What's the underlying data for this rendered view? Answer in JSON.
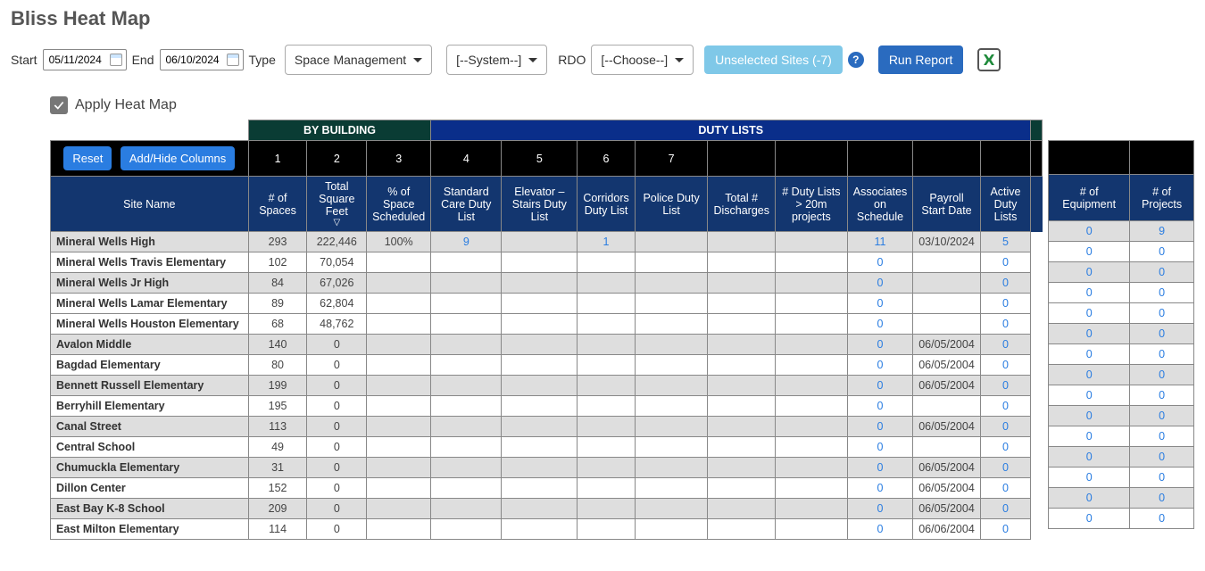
{
  "title": "Bliss Heat Map",
  "controls": {
    "start_label": "Start",
    "start_value": "05/11/2024",
    "end_label": "End",
    "end_value": "06/10/2024",
    "type_label": "Type",
    "type_value": "Space Management",
    "system_value": "[--System--]",
    "rdo_label": "RDO",
    "rdo_value": "[--Choose--]",
    "unselected_label": "Unselected Sites (-7)",
    "run_label": "Run Report"
  },
  "apply_heat_map_label": "Apply Heat Map",
  "bands": {
    "by_building": "BY BUILDING",
    "duty_lists": "DUTY LISTS"
  },
  "numcols": [
    "1",
    "2",
    "3",
    "4",
    "5",
    "6",
    "7"
  ],
  "buttons": {
    "reset": "Reset",
    "addhide": "Add/Hide Columns"
  },
  "headers": {
    "site": "Site Name",
    "spaces": "# of Spaces",
    "sqft": "Total Square Feet",
    "pct_sched": "% of Space Scheduled",
    "std_care": "Standard Care Duty List",
    "elevator": "Elevator – Stairs Duty List",
    "corridors": "Corridors Duty List",
    "police": "Police Duty List",
    "discharges": "Total # Discharges",
    "duty20m": "# Duty Lists > 20m projects",
    "assoc": "Associates on Schedule",
    "payroll": "Payroll Start Date",
    "active": "Active Duty Lists",
    "equip": "# of Equipment",
    "projects": "# of Projects"
  },
  "rows": [
    {
      "shade": true,
      "site": "Mineral Wells High",
      "spaces": "293",
      "sqft": "222,446",
      "pct": "100%",
      "std": "9",
      "elev": "",
      "corr": "1",
      "pol": "",
      "disch": "",
      "d20": "",
      "assoc": "11",
      "payroll": "03/10/2024",
      "active": "5",
      "equip": "0",
      "proj": "9"
    },
    {
      "shade": false,
      "site": "Mineral Wells Travis Elementary",
      "spaces": "102",
      "sqft": "70,054",
      "pct": "",
      "std": "",
      "elev": "",
      "corr": "",
      "pol": "",
      "disch": "",
      "d20": "",
      "assoc": "0",
      "payroll": "",
      "active": "0",
      "equip": "0",
      "proj": "0"
    },
    {
      "shade": true,
      "site": "Mineral Wells Jr High",
      "spaces": "84",
      "sqft": "67,026",
      "pct": "",
      "std": "",
      "elev": "",
      "corr": "",
      "pol": "",
      "disch": "",
      "d20": "",
      "assoc": "0",
      "payroll": "",
      "active": "0",
      "equip": "0",
      "proj": "0"
    },
    {
      "shade": false,
      "site": "Mineral Wells Lamar Elementary",
      "spaces": "89",
      "sqft": "62,804",
      "pct": "",
      "std": "",
      "elev": "",
      "corr": "",
      "pol": "",
      "disch": "",
      "d20": "",
      "assoc": "0",
      "payroll": "",
      "active": "0",
      "equip": "0",
      "proj": "0"
    },
    {
      "shade": false,
      "site": "Mineral Wells Houston Elementary",
      "spaces": "68",
      "sqft": "48,762",
      "pct": "",
      "std": "",
      "elev": "",
      "corr": "",
      "pol": "",
      "disch": "",
      "d20": "",
      "assoc": "0",
      "payroll": "",
      "active": "0",
      "equip": "0",
      "proj": "0"
    },
    {
      "shade": true,
      "site": "Avalon Middle",
      "spaces": "140",
      "sqft": "0",
      "pct": "",
      "std": "",
      "elev": "",
      "corr": "",
      "pol": "",
      "disch": "",
      "d20": "",
      "assoc": "0",
      "payroll": "06/05/2004",
      "active": "0",
      "equip": "0",
      "proj": "0"
    },
    {
      "shade": false,
      "site": "Bagdad Elementary",
      "spaces": "80",
      "sqft": "0",
      "pct": "",
      "std": "",
      "elev": "",
      "corr": "",
      "pol": "",
      "disch": "",
      "d20": "",
      "assoc": "0",
      "payroll": "06/05/2004",
      "active": "0",
      "equip": "0",
      "proj": "0"
    },
    {
      "shade": true,
      "site": "Bennett Russell Elementary",
      "spaces": "199",
      "sqft": "0",
      "pct": "",
      "std": "",
      "elev": "",
      "corr": "",
      "pol": "",
      "disch": "",
      "d20": "",
      "assoc": "0",
      "payroll": "06/05/2004",
      "active": "0",
      "equip": "0",
      "proj": "0"
    },
    {
      "shade": false,
      "site": "Berryhill Elementary",
      "spaces": "195",
      "sqft": "0",
      "pct": "",
      "std": "",
      "elev": "",
      "corr": "",
      "pol": "",
      "disch": "",
      "d20": "",
      "assoc": "0",
      "payroll": "",
      "active": "0",
      "equip": "0",
      "proj": "0"
    },
    {
      "shade": true,
      "site": "Canal Street",
      "spaces": "113",
      "sqft": "0",
      "pct": "",
      "std": "",
      "elev": "",
      "corr": "",
      "pol": "",
      "disch": "",
      "d20": "",
      "assoc": "0",
      "payroll": "06/05/2004",
      "active": "0",
      "equip": "0",
      "proj": "0"
    },
    {
      "shade": false,
      "site": "Central School",
      "spaces": "49",
      "sqft": "0",
      "pct": "",
      "std": "",
      "elev": "",
      "corr": "",
      "pol": "",
      "disch": "",
      "d20": "",
      "assoc": "0",
      "payroll": "",
      "active": "0",
      "equip": "0",
      "proj": "0"
    },
    {
      "shade": true,
      "site": "Chumuckla Elementary",
      "spaces": "31",
      "sqft": "0",
      "pct": "",
      "std": "",
      "elev": "",
      "corr": "",
      "pol": "",
      "disch": "",
      "d20": "",
      "assoc": "0",
      "payroll": "06/05/2004",
      "active": "0",
      "equip": "0",
      "proj": "0"
    },
    {
      "shade": false,
      "site": "Dillon Center",
      "spaces": "152",
      "sqft": "0",
      "pct": "",
      "std": "",
      "elev": "",
      "corr": "",
      "pol": "",
      "disch": "",
      "d20": "",
      "assoc": "0",
      "payroll": "06/05/2004",
      "active": "0",
      "equip": "0",
      "proj": "0"
    },
    {
      "shade": true,
      "site": "East Bay K-8 School",
      "spaces": "209",
      "sqft": "0",
      "pct": "",
      "std": "",
      "elev": "",
      "corr": "",
      "pol": "",
      "disch": "",
      "d20": "",
      "assoc": "0",
      "payroll": "06/05/2004",
      "active": "0",
      "equip": "0",
      "proj": "0"
    },
    {
      "shade": false,
      "site": "East Milton Elementary",
      "spaces": "114",
      "sqft": "0",
      "pct": "",
      "std": "",
      "elev": "",
      "corr": "",
      "pol": "",
      "disch": "",
      "d20": "",
      "assoc": "0",
      "payroll": "06/06/2004",
      "active": "0",
      "equip": "0",
      "proj": "0"
    }
  ]
}
